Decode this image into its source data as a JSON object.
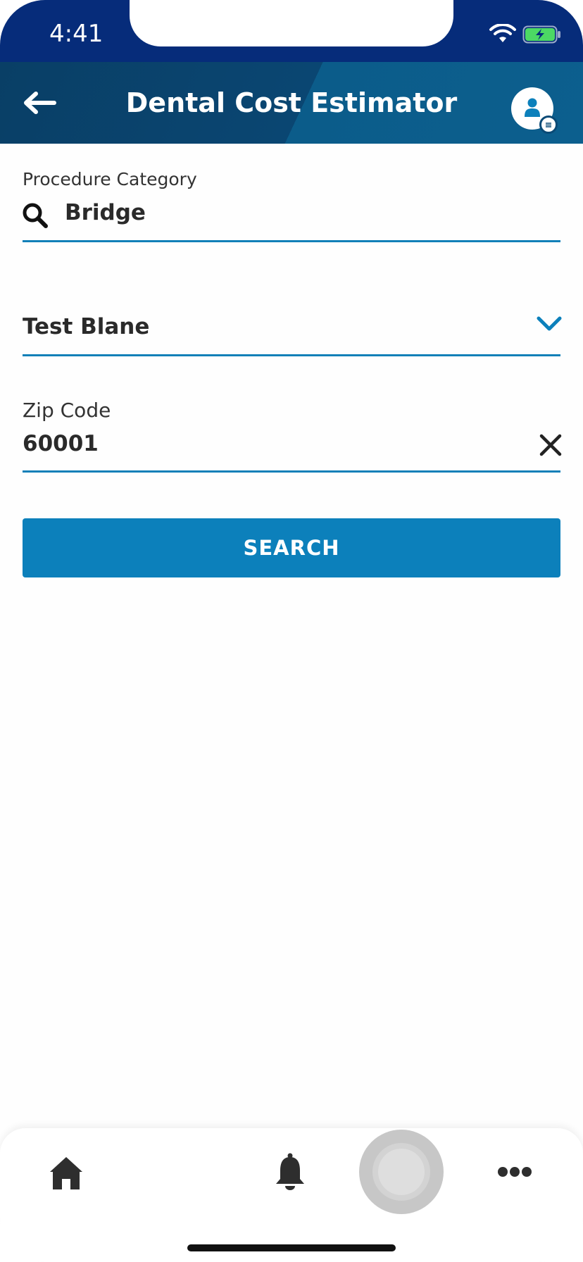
{
  "status_bar": {
    "time": "4:41"
  },
  "header": {
    "title": "Dental Cost Estimator",
    "back_icon": "arrow-left-icon",
    "profile_icon": "user-icon"
  },
  "form": {
    "procedure": {
      "label": "Procedure Category",
      "value": "Bridge",
      "icon": "search-icon"
    },
    "member": {
      "value": "Test Blane",
      "icon": "chevron-down-icon"
    },
    "zip": {
      "label": "Zip Code",
      "value": "60001",
      "icon": "close-icon"
    },
    "search_label": "SEARCH"
  },
  "bottom_nav": {
    "items": [
      {
        "icon": "home-icon"
      },
      {
        "icon": "bell-icon"
      },
      {
        "icon": "assistant-icon"
      },
      {
        "icon": "more-icon"
      }
    ]
  },
  "colors": {
    "status_bar": "#062c7a",
    "header": "#0a4672",
    "accent": "#0c80bb"
  }
}
